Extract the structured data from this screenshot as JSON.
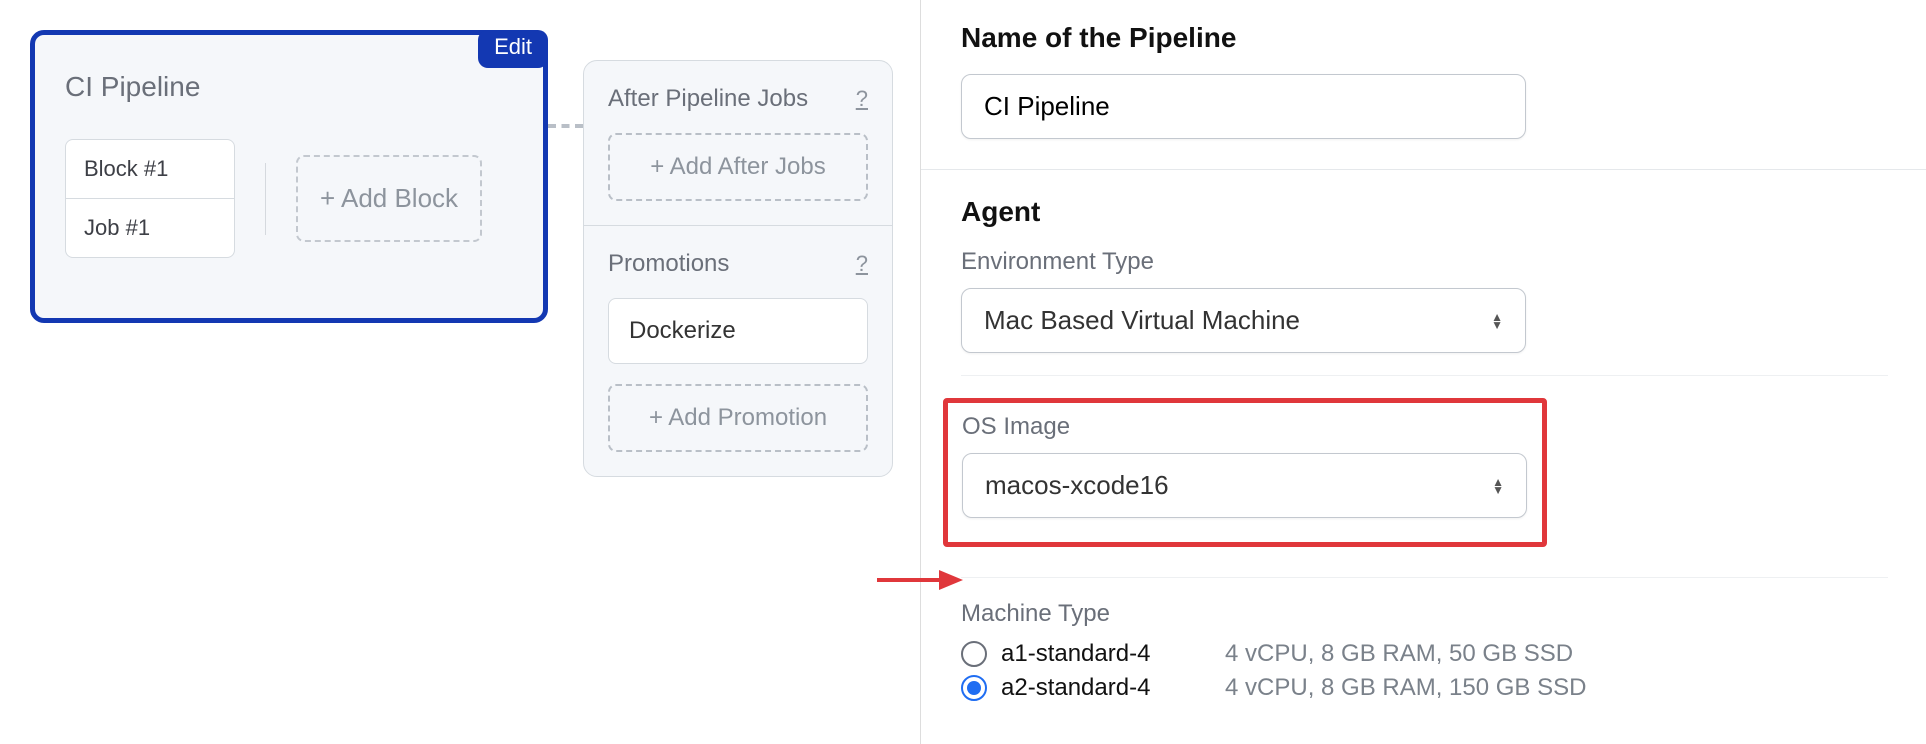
{
  "pipeline": {
    "title": "CI Pipeline",
    "edit_label": "Edit",
    "block_name": "Block #1",
    "job_name": "Job #1",
    "add_block_label": "+ Add Block"
  },
  "after_jobs": {
    "title": "After Pipeline Jobs",
    "help": "?",
    "add_label": "+ Add After Jobs"
  },
  "promotions": {
    "title": "Promotions",
    "help": "?",
    "item": "Dockerize",
    "add_label": "+ Add Promotion"
  },
  "form": {
    "name_section": "Name of the Pipeline",
    "name_value": "CI Pipeline",
    "agent_section": "Agent",
    "env_label": "Environment Type",
    "env_value": "Mac Based Virtual Machine",
    "os_label": "OS Image",
    "os_value": "macos-xcode16",
    "machine_label": "Machine Type",
    "machines": [
      {
        "name": "a1-standard-4",
        "spec": "4 vCPU, 8 GB RAM, 50 GB SSD",
        "checked": false
      },
      {
        "name": "a2-standard-4",
        "spec": "4 vCPU, 8 GB RAM, 150 GB SSD",
        "checked": true
      }
    ]
  }
}
